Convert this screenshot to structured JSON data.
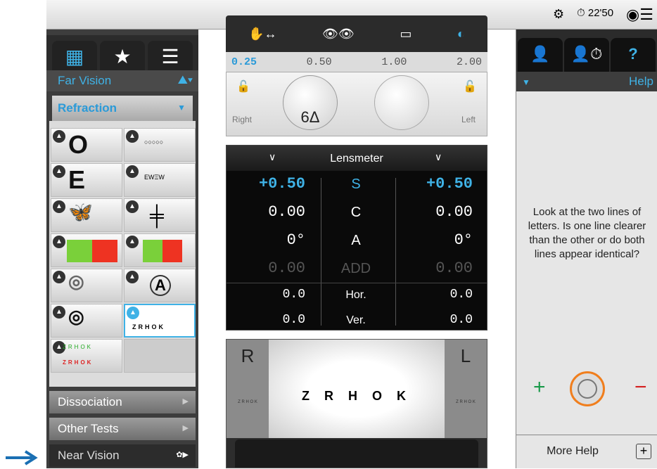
{
  "topbar": {
    "time": "22'50"
  },
  "left": {
    "far_vision": "Far Vision",
    "refraction": "Refraction",
    "dissociation": "Dissociation",
    "other_tests": "Other Tests",
    "near_vision": "Near Vision",
    "cells": [
      {
        "symbol": "O"
      },
      {
        "symbol": "E"
      },
      {
        "symbol": "🦋"
      },
      {
        "symbol": "RG"
      },
      {
        "symbol": "◎"
      },
      {
        "symbol": "◎"
      },
      {
        "symbol": "ZRHOK"
      }
    ]
  },
  "scale": {
    "values": [
      "0.25",
      "0.50",
      "1.00",
      "2.00"
    ],
    "active": "0.25"
  },
  "eyes": {
    "right": "Right",
    "left": "Left",
    "prism": "6Δ"
  },
  "lensmeter": {
    "title": "Lensmeter",
    "rows": [
      {
        "v1": "+0.50",
        "label": "S",
        "v2": "+0.50"
      },
      {
        "v1": "0.00",
        "label": "C",
        "v2": "0.00"
      },
      {
        "v1": "0°",
        "label": "A",
        "v2": "0°"
      },
      {
        "v1": "0.00",
        "label": "ADD",
        "v2": "0.00"
      },
      {
        "v1": "0.0",
        "label": "Hor.",
        "v2": "0.0"
      },
      {
        "v1": "0.0",
        "label": "Ver.",
        "v2": "0.0"
      }
    ]
  },
  "preview": {
    "r": "R",
    "l": "L",
    "chart": "Z R H O K"
  },
  "help": {
    "title": "Help",
    "text": "Look at the two lines of letters. Is one line clearer than the other or do both lines appear identical?",
    "more": "More Help"
  }
}
